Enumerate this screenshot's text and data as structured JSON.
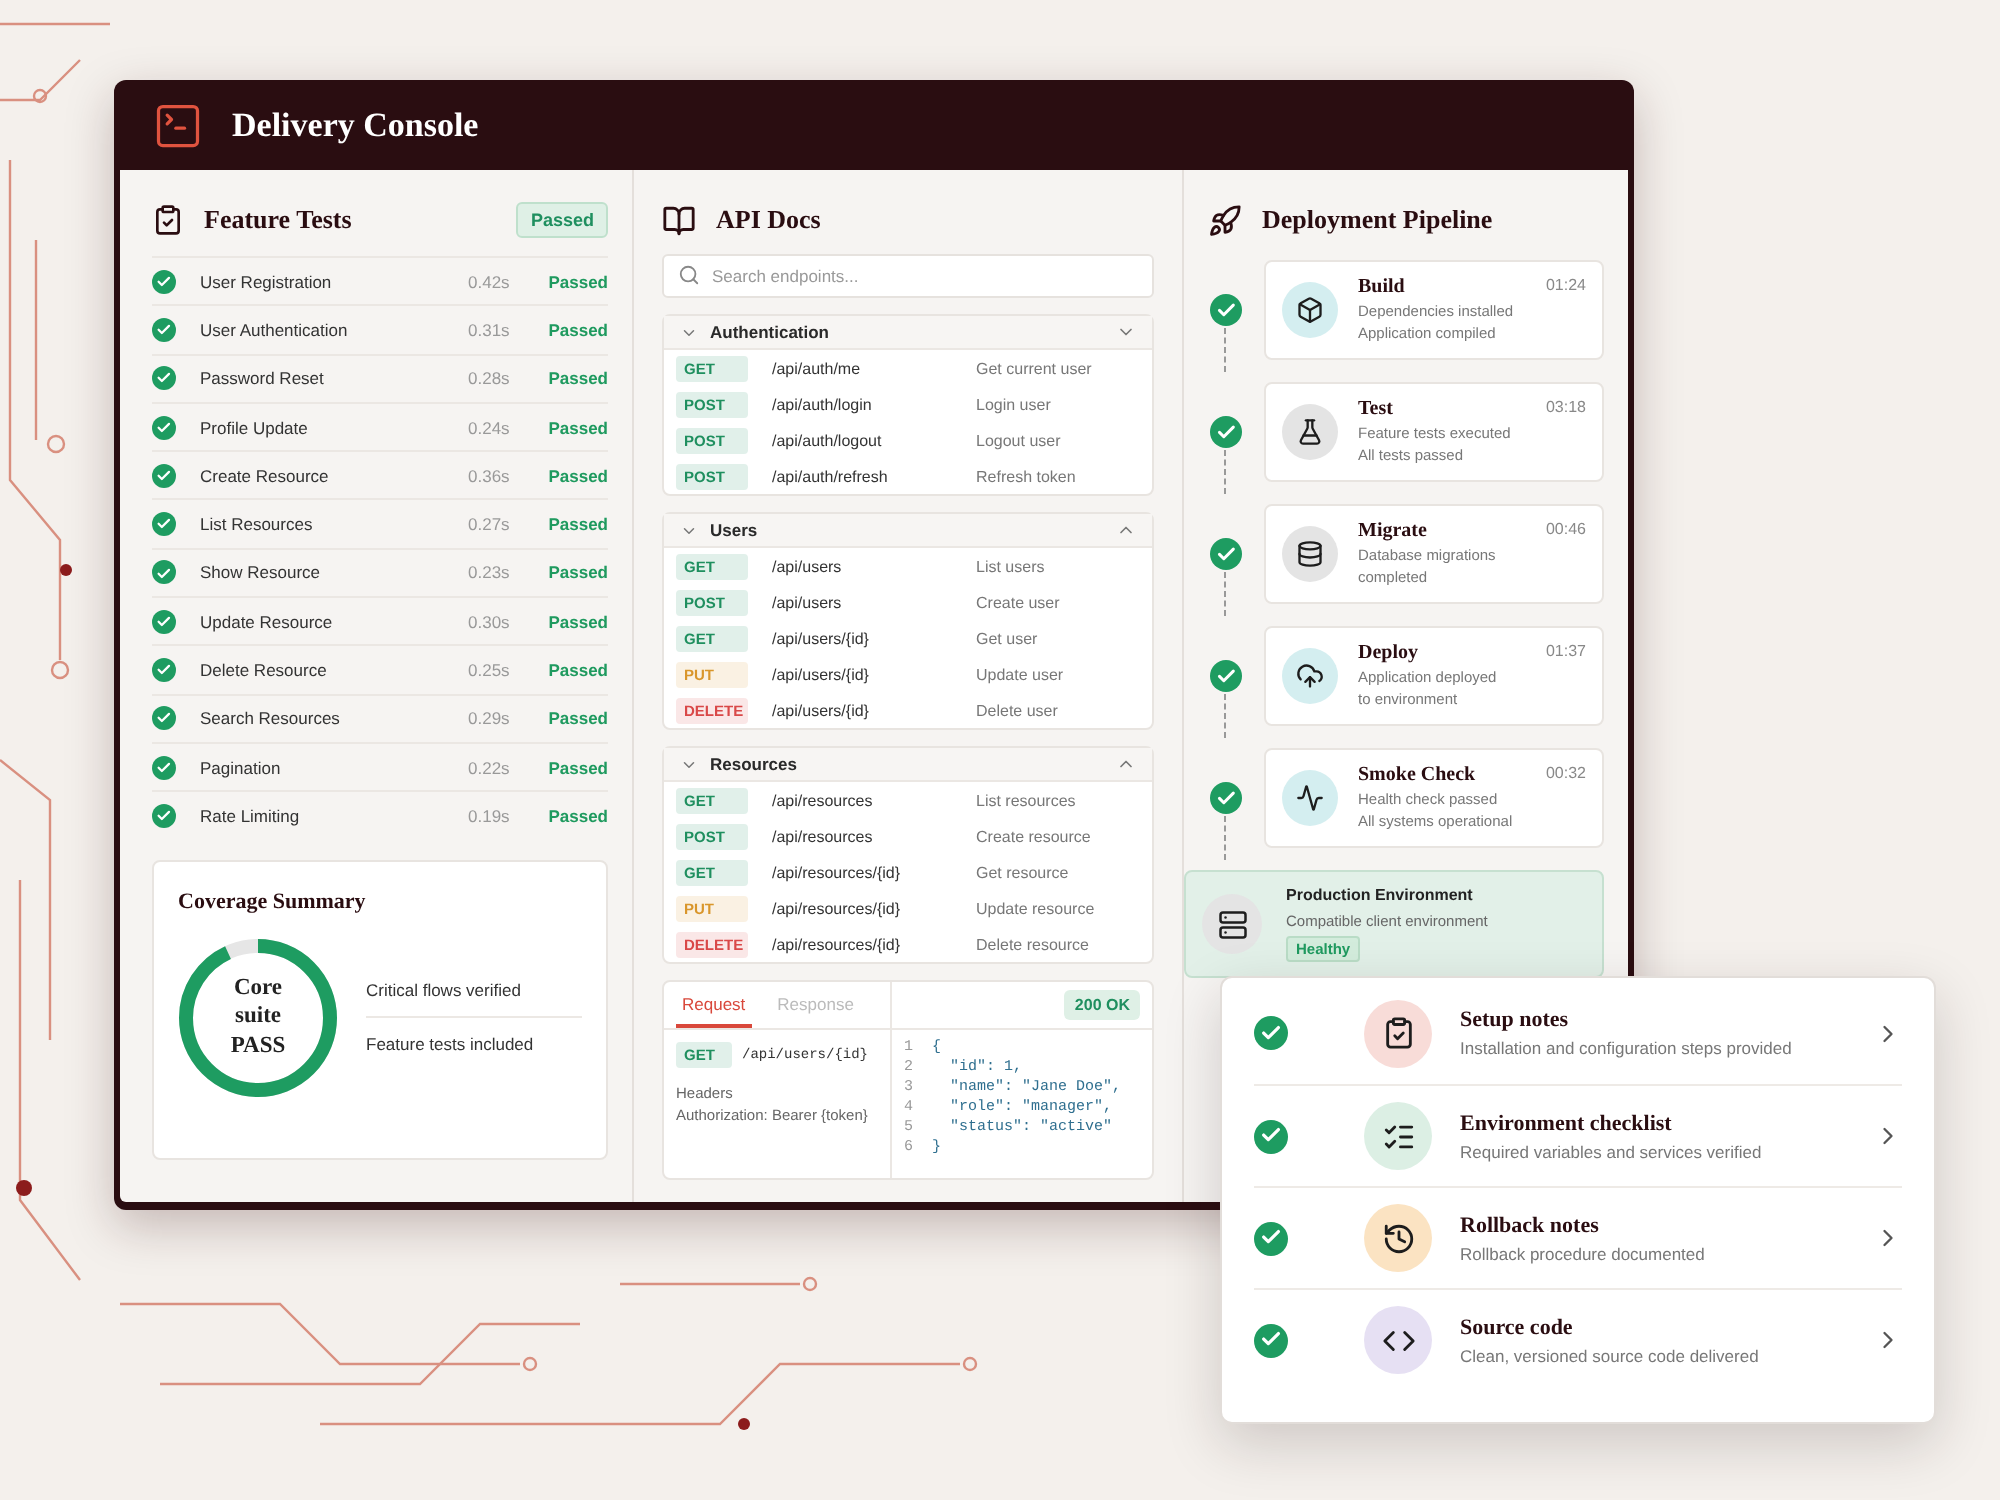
{
  "window": {
    "title": "Delivery Console"
  },
  "feature_tests": {
    "title": "Feature Tests",
    "badge": "Passed",
    "tests": [
      {
        "name": "User Registration",
        "duration": "0.42s",
        "status": "Passed"
      },
      {
        "name": "User Authentication",
        "duration": "0.31s",
        "status": "Passed"
      },
      {
        "name": "Password Reset",
        "duration": "0.28s",
        "status": "Passed"
      },
      {
        "name": "Profile Update",
        "duration": "0.24s",
        "status": "Passed"
      },
      {
        "name": "Create Resource",
        "duration": "0.36s",
        "status": "Passed"
      },
      {
        "name": "List Resources",
        "duration": "0.27s",
        "status": "Passed"
      },
      {
        "name": "Show Resource",
        "duration": "0.23s",
        "status": "Passed"
      },
      {
        "name": "Update Resource",
        "duration": "0.30s",
        "status": "Passed"
      },
      {
        "name": "Delete Resource",
        "duration": "0.25s",
        "status": "Passed"
      },
      {
        "name": "Search Resources",
        "duration": "0.29s",
        "status": "Passed"
      },
      {
        "name": "Pagination",
        "duration": "0.22s",
        "status": "Passed"
      },
      {
        "name": "Rate Limiting",
        "duration": "0.19s",
        "status": "Passed"
      }
    ]
  },
  "coverage": {
    "title": "Coverage Summary",
    "ring_label": "Core suite PASS",
    "level": 0.93,
    "items": [
      "Critical flows verified",
      "Feature tests included"
    ]
  },
  "api_docs": {
    "title": "API Docs",
    "search": {
      "placeholder": "Search endpoints..."
    },
    "groups": [
      {
        "name": "Authentication",
        "kind": "down",
        "endpoints": [
          {
            "method": "GET",
            "color": "#1f8f5f",
            "path": "/api/auth/me",
            "description": "Get current user"
          },
          {
            "method": "POST",
            "color": "#1f8f5f",
            "path": "/api/auth/login",
            "description": "Login user"
          },
          {
            "method": "POST",
            "color": "#1f8f5f",
            "path": "/api/auth/logout",
            "description": "Logout user"
          },
          {
            "method": "POST",
            "color": "#1f8f5f",
            "path": "/api/auth/refresh",
            "description": "Refresh token"
          }
        ]
      },
      {
        "name": "Users",
        "kind": "up",
        "endpoints": [
          {
            "method": "GET",
            "color": "#1f8f5f",
            "path": "/api/users",
            "description": "List users"
          },
          {
            "method": "POST",
            "color": "#1f8f5f",
            "path": "/api/users",
            "description": "Create user"
          },
          {
            "method": "GET",
            "color": "#1f8f5f",
            "path": "/api/users/{id}",
            "description": "Get user"
          },
          {
            "method": "PUT",
            "color": "#d9962b",
            "path": "/api/users/{id}",
            "description": "Update user"
          },
          {
            "method": "DELETE",
            "color": "#d94848",
            "path": "/api/users/{id}",
            "description": "Delete user"
          }
        ]
      },
      {
        "name": "Resources",
        "kind": "up",
        "endpoints": [
          {
            "method": "GET",
            "color": "#1f8f5f",
            "path": "/api/resources",
            "description": "List resources"
          },
          {
            "method": "POST",
            "color": "#1f8f5f",
            "path": "/api/resources",
            "description": "Create resource"
          },
          {
            "method": "GET",
            "color": "#1f8f5f",
            "path": "/api/resources/{id}",
            "description": "Get resource"
          },
          {
            "method": "PUT",
            "color": "#d9962b",
            "path": "/api/resources/{id}",
            "description": "Update resource"
          },
          {
            "method": "DELETE",
            "color": "#d94848",
            "path": "/api/resources/{id}",
            "description": "Delete resource"
          }
        ]
      }
    ],
    "request": {
      "tabs": [
        {
          "label": "Request",
          "selected": true
        },
        {
          "label": "Response",
          "selected": false
        }
      ],
      "status": "200 OK",
      "method": "GET",
      "path": "/api/users/{id}",
      "headers_label": "Headers",
      "header": "Authorization: Bearer {token}",
      "code": [
        {
          "number": "1",
          "text": "{"
        },
        {
          "number": "2",
          "text": "  \"id\": 1,"
        },
        {
          "number": "3",
          "text": "  \"name\": \"Jane Doe\","
        },
        {
          "number": "4",
          "text": "  \"role\": \"manager\","
        },
        {
          "number": "5",
          "text": "  \"status\": \"active\""
        },
        {
          "number": "6",
          "text": "}"
        }
      ]
    }
  },
  "pipeline": {
    "title": "Deployment Pipeline",
    "steps": [
      {
        "kind": "build",
        "name": "Build",
        "time": "01:24",
        "lines": [
          "Dependencies installed",
          "Application compiled"
        ]
      },
      {
        "kind": "test",
        "name": "Test",
        "time": "03:18",
        "lines": [
          "Feature tests executed",
          "All tests passed"
        ]
      },
      {
        "kind": "migrate",
        "name": "Migrate",
        "time": "00:46",
        "lines": [
          "Database migrations",
          "completed"
        ]
      },
      {
        "kind": "deploy",
        "name": "Deploy",
        "time": "01:37",
        "lines": [
          "Application deployed",
          "to environment"
        ]
      },
      {
        "kind": "smoke",
        "name": "Smoke Check",
        "time": "00:32",
        "lines": [
          "Health check passed",
          "All systems operational"
        ]
      }
    ],
    "environment": {
      "title": "Production Environment",
      "description": "Compatible client environment",
      "badge": "Healthy"
    }
  },
  "deliverables": [
    {
      "kind": "notes",
      "title": "Setup notes",
      "description": "Installation and configuration steps provided"
    },
    {
      "kind": "checklist",
      "title": "Environment checklist",
      "description": "Required variables and services verified"
    },
    {
      "kind": "rollback",
      "title": "Rollback notes",
      "description": "Rollback procedure documented"
    },
    {
      "kind": "code",
      "title": "Source code",
      "description": "Clean, versioned source code delivered"
    }
  ]
}
